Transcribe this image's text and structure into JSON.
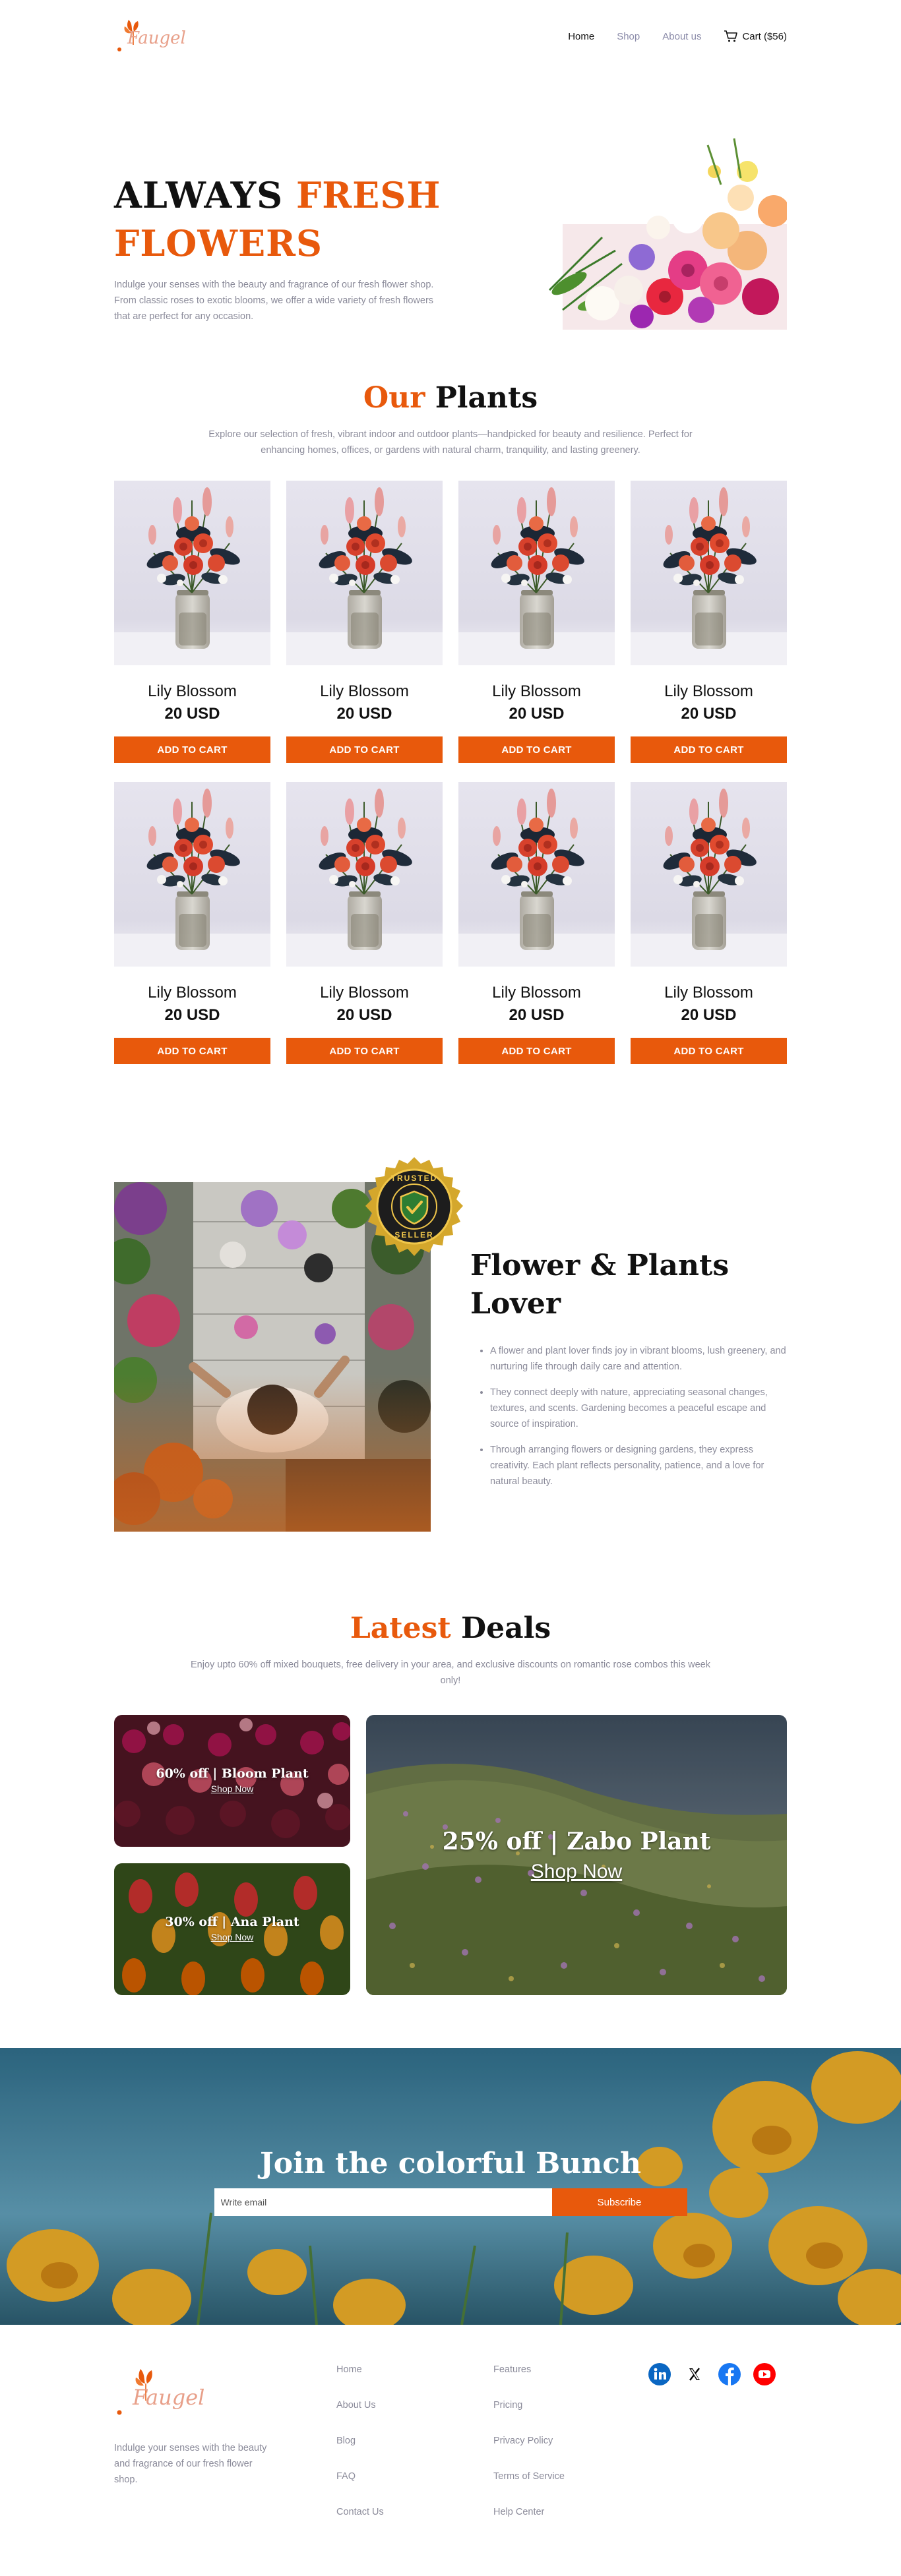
{
  "header": {
    "logo_text": "Faugel",
    "nav": [
      {
        "label": "Home"
      },
      {
        "label": "Shop"
      },
      {
        "label": "About us"
      }
    ],
    "cart_label": "Cart ($56)"
  },
  "hero": {
    "title_part1": "ALWAYS ",
    "title_accent1": "FRESH",
    "title_accent2": "FLOWERS",
    "description": "Indulge your senses with the beauty and fragrance of our fresh flower shop. From classic roses to exotic blooms, we offer a wide variety of fresh flowers that are perfect for any occasion."
  },
  "plants": {
    "title_accent": "Our",
    "title_rest": " Plants",
    "subtitle": "Explore our selection of fresh, vibrant indoor and outdoor plants—handpicked for beauty and resilience. Perfect for enhancing homes, offices, or gardens with natural charm, tranquility, and lasting greenery.",
    "products": [
      {
        "name": "Lily Blossom",
        "price": "20 USD",
        "button": "ADD TO CART"
      },
      {
        "name": "Lily Blossom",
        "price": "20 USD",
        "button": "ADD TO CART"
      },
      {
        "name": "Lily Blossom",
        "price": "20 USD",
        "button": "ADD TO CART"
      },
      {
        "name": "Lily Blossom",
        "price": "20 USD",
        "button": "ADD TO CART"
      },
      {
        "name": "Lily Blossom",
        "price": "20 USD",
        "button": "ADD TO CART"
      },
      {
        "name": "Lily Blossom",
        "price": "20 USD",
        "button": "ADD TO CART"
      },
      {
        "name": "Lily Blossom",
        "price": "20 USD",
        "button": "ADD TO CART"
      },
      {
        "name": "Lily Blossom",
        "price": "20 USD",
        "button": "ADD TO CART"
      }
    ]
  },
  "lover": {
    "badge_top": "TRUSTED",
    "badge_bottom": "SELLER",
    "title": "Flower & Plants Lover",
    "points": [
      "A flower and plant lover finds joy in vibrant blooms, lush greenery, and nurturing life through daily care and attention.",
      "They connect deeply with nature, appreciating seasonal changes, textures, and scents. Gardening becomes a peaceful escape and source of inspiration.",
      "Through arranging flowers or designing gardens, they express creativity. Each plant reflects personality, patience, and a love for natural beauty."
    ]
  },
  "deals": {
    "title_accent": "Latest",
    "title_rest": " Deals",
    "subtitle": "Enjoy upto 60% off mixed bouquets, free delivery in your area, and exclusive discounts on romantic rose combos this week only!",
    "items": [
      {
        "title": "60% off | Bloom Plant",
        "link": "Shop Now"
      },
      {
        "title": "30% off | Ana Plant",
        "link": "Shop Now"
      },
      {
        "title": "25% off | Zabo Plant",
        "link": "Shop Now"
      }
    ]
  },
  "newsletter": {
    "title": "Join the colorful Bunch",
    "placeholder": "Write email",
    "button": "Subscribe"
  },
  "footer": {
    "description": "Indulge your senses with the beauty and fragrance of our fresh flower shop.",
    "col1": [
      {
        "label": "Home"
      },
      {
        "label": "About Us"
      },
      {
        "label": "Blog"
      },
      {
        "label": "FAQ"
      },
      {
        "label": "Contact Us"
      }
    ],
    "col2": [
      {
        "label": "Features"
      },
      {
        "label": "Pricing"
      },
      {
        "label": "Privacy Policy"
      },
      {
        "label": "Terms of Service"
      },
      {
        "label": "Help Center"
      }
    ],
    "social": [
      {
        "icon": "linkedin-icon",
        "color": "#0a66c2"
      },
      {
        "icon": "x-icon",
        "color": "#000000"
      },
      {
        "icon": "facebook-icon",
        "color": "#1877f2"
      },
      {
        "icon": "youtube-icon",
        "color": "#ff0000"
      }
    ]
  },
  "colors": {
    "accent": "#e8590c",
    "muted_text": "#8b8b9a"
  }
}
